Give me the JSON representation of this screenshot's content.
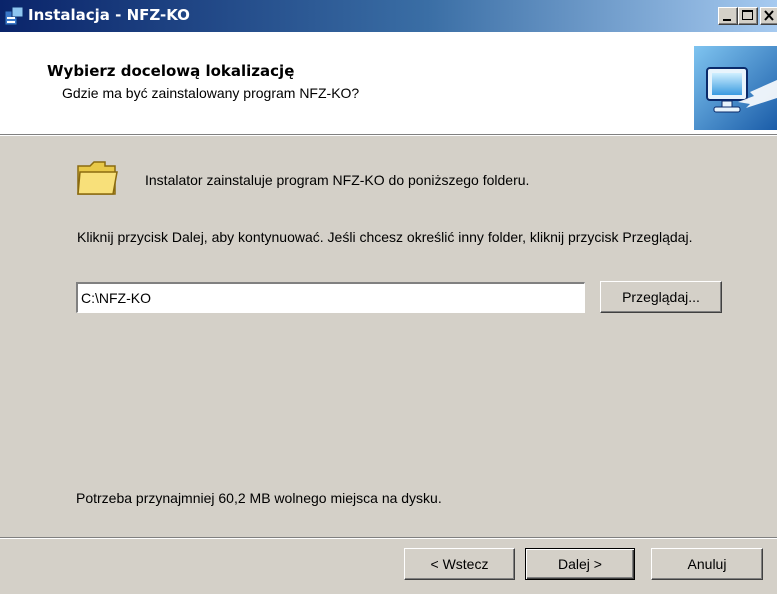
{
  "window": {
    "title": "Instalacja - NFZ-KO"
  },
  "header": {
    "title": "Wybierz docelową lokalizację",
    "subtitle": "Gdzie ma być zainstalowany program NFZ-KO?"
  },
  "content": {
    "intro": "Instalator zainstaluje program NFZ-KO do poniższego folderu.",
    "instructions": "Kliknij przycisk Dalej, aby kontynuować. Jeśli chcesz określić inny folder, kliknij przycisk Przeglądaj.",
    "path_value": "C:\\NFZ-KO",
    "browse_label": "Przeglądaj...",
    "disk_space": "Potrzeba przynajmniej 60,2 MB wolnego miejsca na dysku."
  },
  "footer": {
    "back_label": "< Wstecz",
    "next_label": "Dalej >",
    "cancel_label": "Anuluj"
  },
  "icons": {
    "app": "installer-icon",
    "header": "computer-monitor-icon",
    "folder": "folder-icon",
    "minimize": "minimize-icon",
    "maximize": "maximize-icon",
    "close": "close-icon"
  },
  "colors": {
    "titlebar_start": "#0a246a",
    "titlebar_end": "#a6caf0",
    "face": "#d4d0c8"
  }
}
